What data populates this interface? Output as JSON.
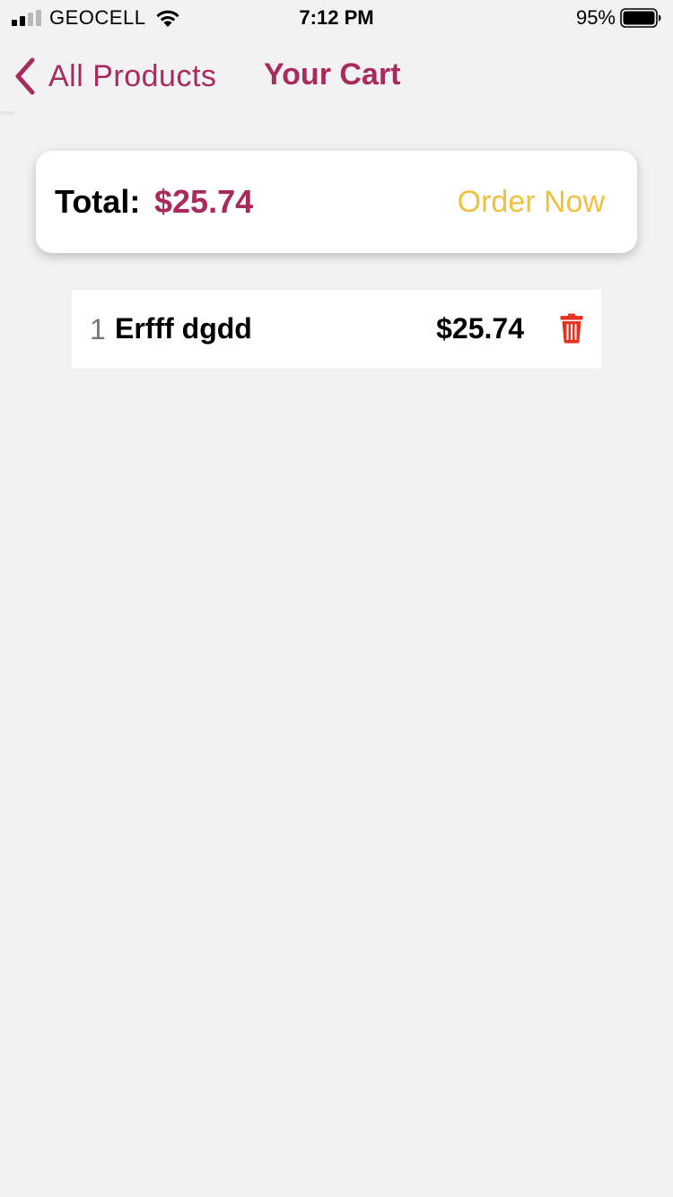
{
  "status_bar": {
    "carrier": "GEOCELL",
    "time": "7:12 PM",
    "battery_percent": "95%",
    "signal_bars": 2,
    "signal_total": 4
  },
  "nav": {
    "back_label": "All Products",
    "title": "Your Cart"
  },
  "summary": {
    "total_label": "Total:",
    "total_amount": "$25.74",
    "order_button": "Order Now"
  },
  "cart_items": [
    {
      "quantity": "1",
      "name": "Erfff dgdd",
      "price": "$25.74",
      "delete_icon": "trash-icon"
    }
  ],
  "colors": {
    "brand": "#a92a5c",
    "order_button": "#f0c040",
    "delete": "#e53222",
    "background": "#f2f2f2"
  }
}
